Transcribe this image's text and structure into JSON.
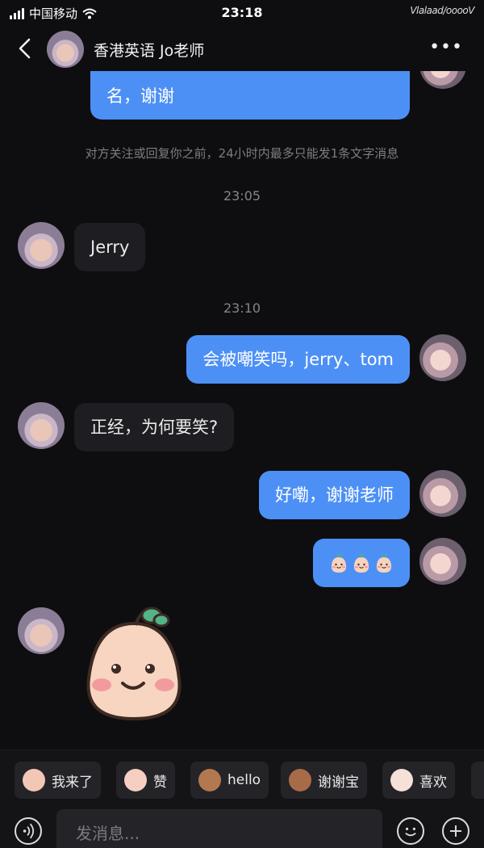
{
  "status_bar": {
    "carrier": "中国移动",
    "time": "23:18",
    "right_text": "Vlalaad/ooooV"
  },
  "header": {
    "title": "香港英语 Jo老师"
  },
  "chat": {
    "partial_message": "名，谢谢",
    "notice": "对方关注或回复你之前，24小时内最多只能发1条文字消息",
    "time_1": "23:05",
    "msg_jerry": "Jerry",
    "time_2": "23:10",
    "msg_laugh": "会被嘲笑吗，jerry、tom",
    "msg_reply": "正经，为何要笑?",
    "msg_thanks": "好嘞，谢谢老师"
  },
  "quick_replies": [
    "我来了",
    "赞",
    "hello",
    "谢谢宝",
    "喜欢"
  ],
  "composer": {
    "placeholder": "发消息..."
  },
  "colors": {
    "outgoing": "#4d90f5",
    "incoming": "#1e1e22",
    "background": "#0e0e10"
  }
}
